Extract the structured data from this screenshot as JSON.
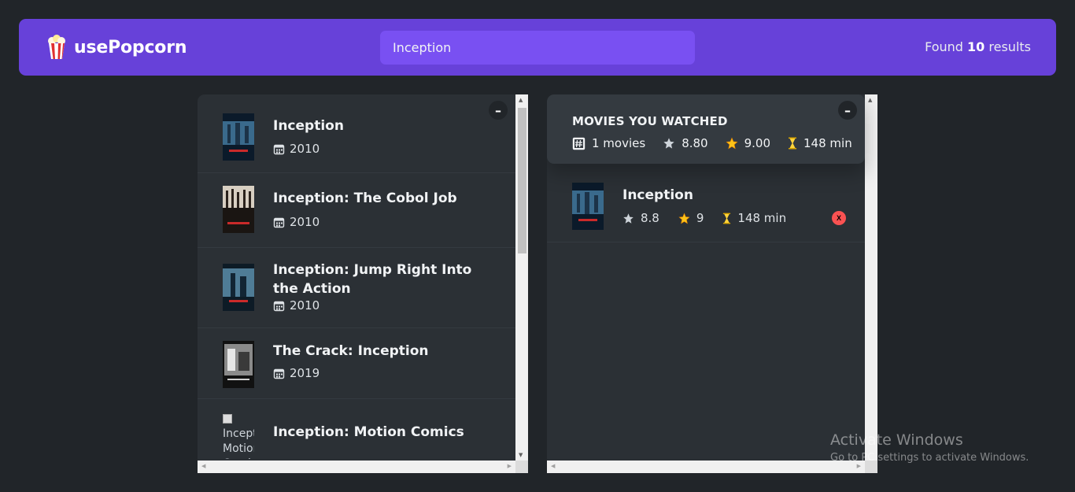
{
  "navbar": {
    "logo_text": "usePopcorn",
    "search_value": "Inception",
    "found_prefix": "Found",
    "found_count": "10",
    "found_suffix": "results"
  },
  "search_list": [
    {
      "title": "Inception",
      "year": "2010"
    },
    {
      "title": "Inception: The Cobol Job",
      "year": "2010"
    },
    {
      "title": "Inception: Jump Right Into the Action",
      "year": "2010"
    },
    {
      "title": "The Crack: Inception",
      "year": "2019"
    },
    {
      "title": "Inception: Motion Comics",
      "year": "",
      "poster_alt": "Inception: Motion Comics"
    }
  ],
  "summary": {
    "heading": "Movies you watched",
    "num_movies": "1 movies",
    "avg_imdb": "8.80",
    "avg_user": "9.00",
    "avg_runtime": "148 min"
  },
  "watched": [
    {
      "title": "Inception",
      "imdb": "8.8",
      "user": "9",
      "runtime": "148 min",
      "delete_label": "X"
    }
  ],
  "toggle_label": "–",
  "watermark": {
    "title": "Activate Windows",
    "subtitle": "Go to PC settings to activate Windows."
  },
  "colors": {
    "navbar": "#6741d9",
    "search": "#7950f2",
    "background": "#212529",
    "box": "#2b3035",
    "summary": "#343a40",
    "delete": "#fa5252"
  }
}
